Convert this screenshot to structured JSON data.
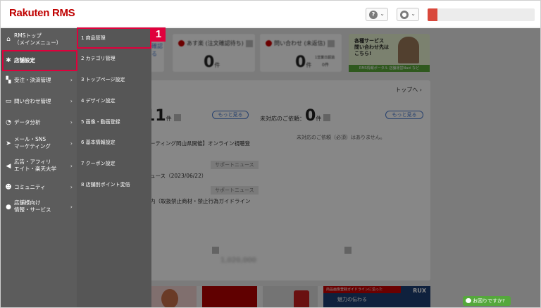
{
  "header": {
    "logo": "Rakuten RMS",
    "help_icon_glyph": "?",
    "user_icon_glyph": "●",
    "chevron": "⌄"
  },
  "sidebar": {
    "items": [
      {
        "name": "rms-top",
        "icon": "home-icon",
        "glyph": "⌂",
        "label": "RMSトップ\n（メインメニュー）",
        "arrow": ""
      },
      {
        "name": "store-settings",
        "icon": "gear-icon",
        "glyph": "✱",
        "label": "店舗設定",
        "arrow": ""
      },
      {
        "name": "orders",
        "icon": "cart-icon",
        "glyph": "▚",
        "label": "受注・決済管理",
        "arrow": "›"
      },
      {
        "name": "inquiries",
        "icon": "chat-icon",
        "glyph": "▭",
        "label": "問い合わせ管理",
        "arrow": "›"
      },
      {
        "name": "data-analysis",
        "icon": "pie-chart-icon",
        "glyph": "◔",
        "label": "データ分析",
        "arrow": "›"
      },
      {
        "name": "mail-sns",
        "icon": "paper-plane-icon",
        "glyph": "➤",
        "label": "メール・SNS\nマーケティング",
        "arrow": "›"
      },
      {
        "name": "ads",
        "icon": "megaphone-icon",
        "glyph": "◀",
        "label": "広告・アフィリ\nエイト・楽天大学",
        "arrow": "›"
      },
      {
        "name": "community",
        "icon": "people-icon",
        "glyph": "☻",
        "label": "コミュニティ",
        "arrow": "›"
      },
      {
        "name": "store-info",
        "icon": "info-icon",
        "glyph": "●",
        "label": "店舗様向け\n情報・サービス",
        "arrow": "›"
      }
    ]
  },
  "submenu": {
    "items": [
      "1 商品管理",
      "2 カテゴリ管理",
      "3 トップページ設定",
      "4 デザイン設定",
      "5 画像・動画登録",
      "6 基本情報設定",
      "7 クーポン設定",
      "8 店舗別ポイント変倍"
    ]
  },
  "annotation": {
    "badge": "1"
  },
  "main": {
    "stat1": {
      "label": "あす楽 (注文確認待ち)",
      "value": "0",
      "unit": "件"
    },
    "stat2": {
      "label": "問い合わせ (未返信)",
      "value": "0",
      "unit": "件",
      "sub": "1営業日超過",
      "sub_value": "0件"
    },
    "partial_link": "確認る",
    "banner": {
      "line1": "各種サービス",
      "line2": "問い合わせ先は",
      "line3": "こちら!",
      "footer": "RMS情報ポータル 店舗運営Navi など"
    },
    "top_link": "トップへ",
    "count_value": "11",
    "count_unit": "件",
    "more_btn": "もっと見る",
    "pending_label": "未対応のご依頼：",
    "pending_value": "0",
    "pending_unit": "件",
    "no_pending": "未対応のご依頼（必須）はありません。",
    "news1": "ーティング岡山県開催】オンライン視聴登",
    "news_tag": "サポートニュース",
    "news2": "ュース（2023/06/22）",
    "news3": "内（取扱禁止商材・禁止行為ガイドライン",
    "sales_figure": "1,020,000",
    "bottom_banner": "商品画像登録ガイドラインに沿った",
    "bottom_banner_sub": "魅力の伝わる",
    "bottom_rux": "RUX"
  },
  "help_button": "お困りですか?"
}
